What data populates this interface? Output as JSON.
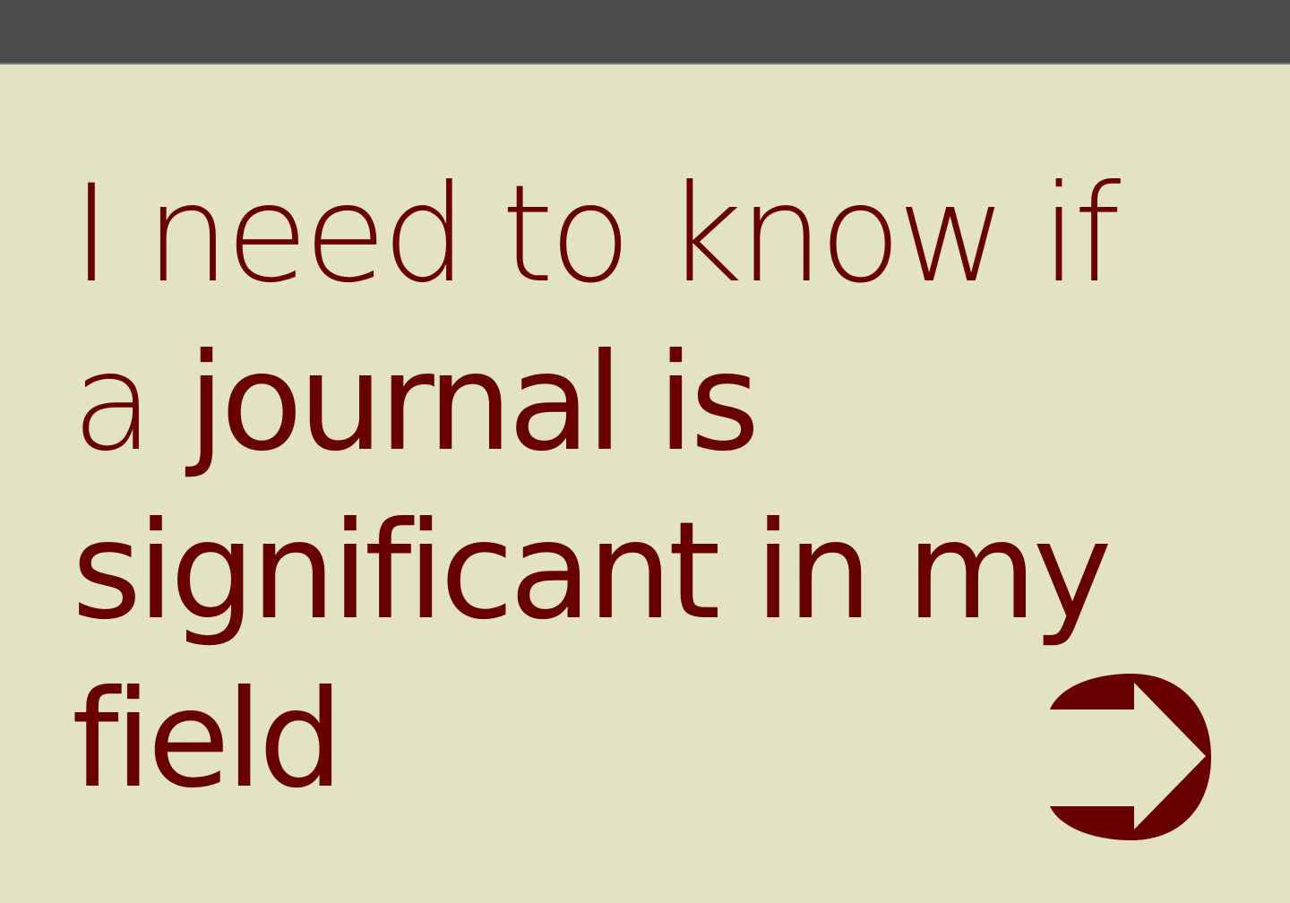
{
  "prompt": {
    "line1": "I need to know if",
    "line2_a": "a ",
    "line2_b": "journal is",
    "line3": "significant in my",
    "line4": "field"
  },
  "next_button": {
    "icon": "arrow-right-icon"
  },
  "colors": {
    "background": "#e3e3c3",
    "top_bar": "#4b4b4b",
    "text": "#680000",
    "accent": "#680000"
  }
}
